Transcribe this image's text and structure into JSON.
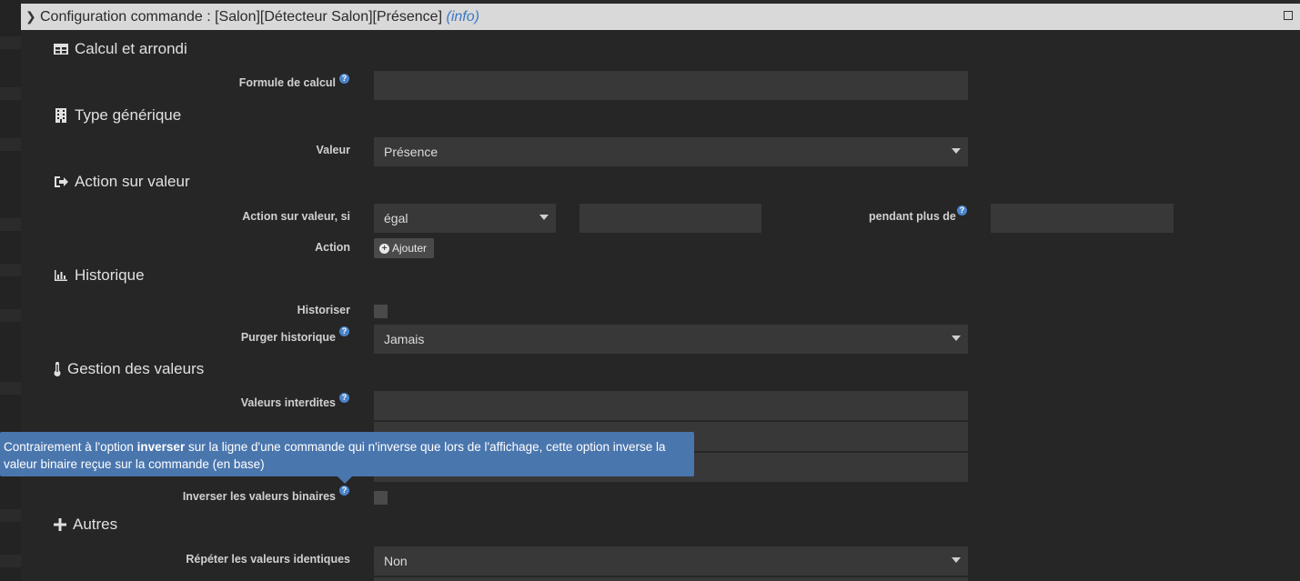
{
  "window": {
    "title_main": "Configuration commande : [Salon][Détecteur Salon][Présence]",
    "title_info": "(info)"
  },
  "sections": {
    "calcul": "Calcul et arrondi",
    "type": "Type générique",
    "action": "Action sur valeur",
    "historique": "Historique",
    "gestion": "Gestion des valeurs",
    "autres": "Autres"
  },
  "fields": {
    "formule_label": "Formule de calcul",
    "valeur_label": "Valeur",
    "valeur_selected": "Présence",
    "action_si_label": "Action sur valeur, si",
    "action_si_selected": "égal",
    "pendant_label": "pendant plus de",
    "action_label": "Action",
    "ajouter_label": "Ajouter",
    "historiser_label": "Historiser",
    "purger_label": "Purger historique",
    "purger_selected": "Jamais",
    "interdites_label": "Valeurs interdites",
    "inverser_label": "Inverser les valeurs binaires",
    "repeter_label": "Répéter les valeurs identiques",
    "repeter_selected": "Non"
  },
  "tooltip": {
    "part1": "Contrairement à l'option ",
    "bold": "inverser",
    "part2": " sur la ligne d'une commande qui n'inverse que lors de l'affichage, cette option inverse la valeur binaire reçue sur la commande (en base)"
  },
  "colors": {
    "accent": "#4a84cc",
    "tooltip_bg": "#4a76ae",
    "modal_bg": "#262626",
    "input_bg": "#383838"
  }
}
